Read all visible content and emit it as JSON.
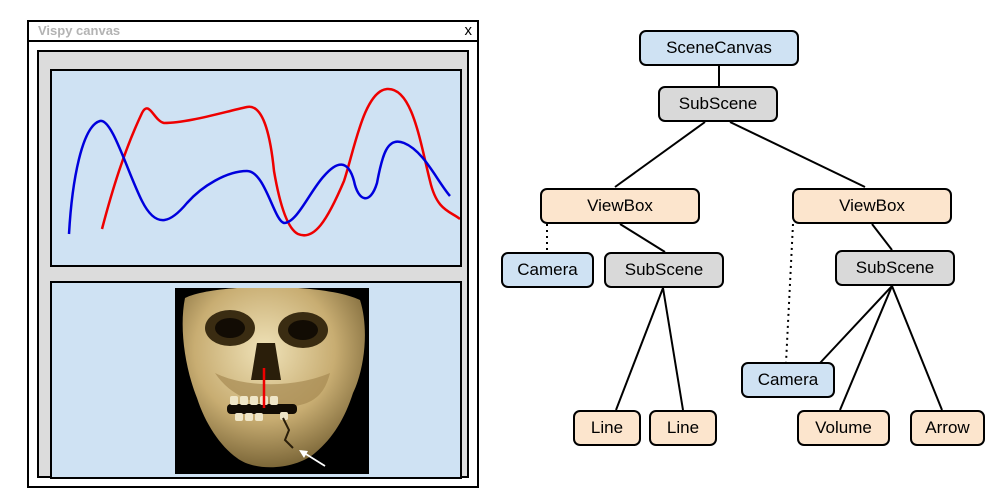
{
  "window": {
    "title": "Vispy canvas",
    "close_label": "x"
  },
  "tree": {
    "root": "SceneCanvas",
    "subscene_top": "SubScene",
    "viewbox_left": "ViewBox",
    "viewbox_right": "ViewBox",
    "camera_left": "Camera",
    "subscene_left": "SubScene",
    "camera_right": "Camera",
    "subscene_right": "SubScene",
    "line_1": "Line",
    "line_2": "Line",
    "volume": "Volume",
    "arrow": "Arrow"
  },
  "colors": {
    "canvas_node": "#cfe2f3",
    "subscene_node": "#d9d9d9",
    "visual_node": "#fce5cd",
    "line_red": "#ee0000",
    "line_blue": "#0000dd"
  }
}
